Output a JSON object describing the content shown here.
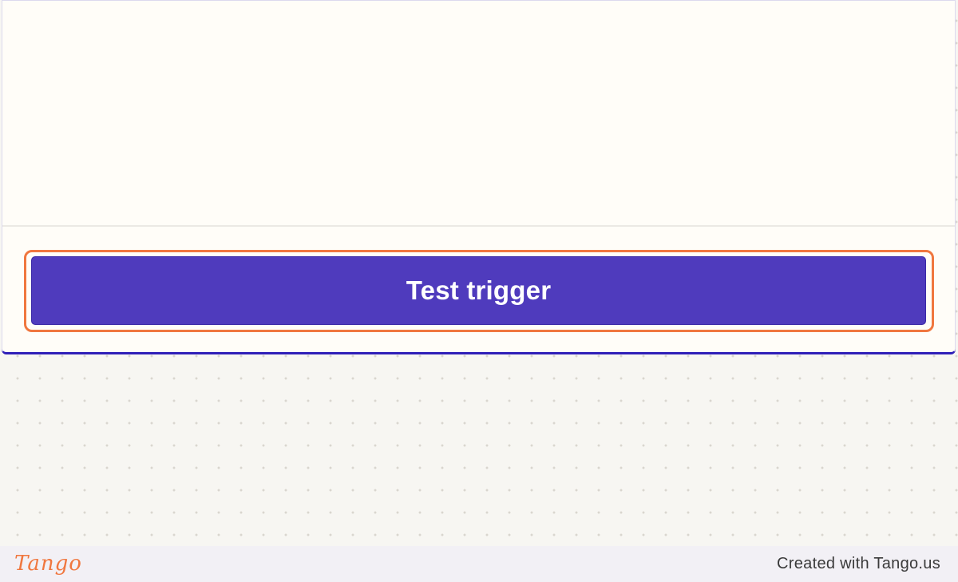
{
  "panel": {
    "button_label": "Test trigger"
  },
  "footer": {
    "brand": "Tango",
    "credit": "Created with Tango.us"
  },
  "colors": {
    "button_bg": "#4f3bbd",
    "highlight": "#f0773f",
    "panel_accent": "#2f1fb8",
    "brand": "#f0773f"
  }
}
